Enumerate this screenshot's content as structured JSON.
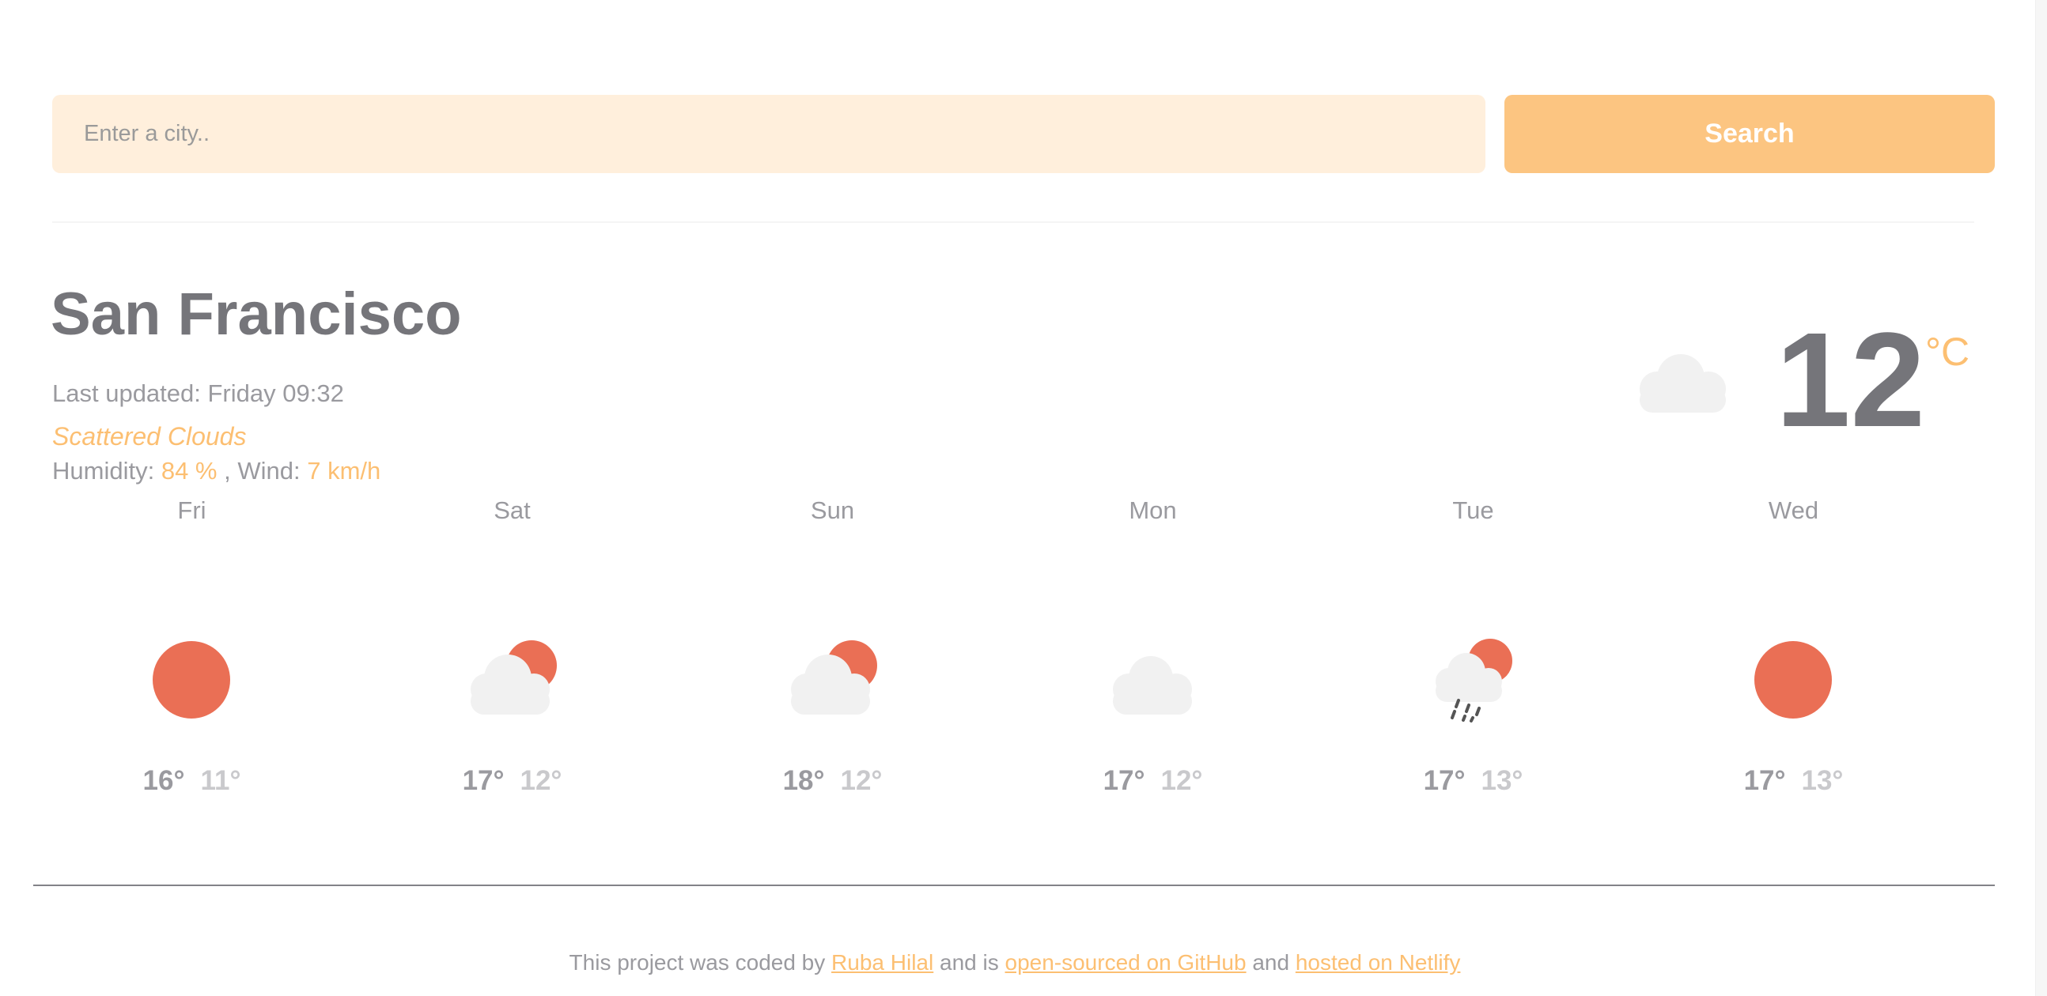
{
  "search": {
    "placeholder": "Enter a city..",
    "button_label": "Search"
  },
  "current": {
    "city": "San Francisco",
    "last_updated": "Last updated: Friday 09:32",
    "description": "Scattered Clouds",
    "humidity_label": "Humidity:",
    "humidity_value": "84 %",
    "wind_label": ", Wind:",
    "wind_value": "7 km/h",
    "temperature": "12",
    "unit": "°C",
    "icon": "cloud-icon"
  },
  "forecast": [
    {
      "day": "Fri",
      "max": "16°",
      "min": "11°",
      "icon": "sun-icon"
    },
    {
      "day": "Sat",
      "max": "17°",
      "min": "12°",
      "icon": "partly-cloudy-icon"
    },
    {
      "day": "Sun",
      "max": "18°",
      "min": "12°",
      "icon": "partly-cloudy-icon"
    },
    {
      "day": "Mon",
      "max": "17°",
      "min": "12°",
      "icon": "cloud-icon"
    },
    {
      "day": "Tue",
      "max": "17°",
      "min": "13°",
      "icon": "rain-sun-icon"
    },
    {
      "day": "Wed",
      "max": "17°",
      "min": "13°",
      "icon": "sun-icon"
    }
  ],
  "footer": {
    "text_1": "This project was coded by",
    "link_author": "Ruba Hilal",
    "text_2": "and is",
    "link_github": "open-sourced on GitHub",
    "text_3": "and",
    "link_netlify": "hosted on Netlify"
  },
  "colors": {
    "accent": "#fcbf72",
    "button": "#fcc581",
    "input_bg": "#ffefdc",
    "sun": "#ea6f55",
    "cloud": "#f1f1f1",
    "heading": "#75757a"
  }
}
